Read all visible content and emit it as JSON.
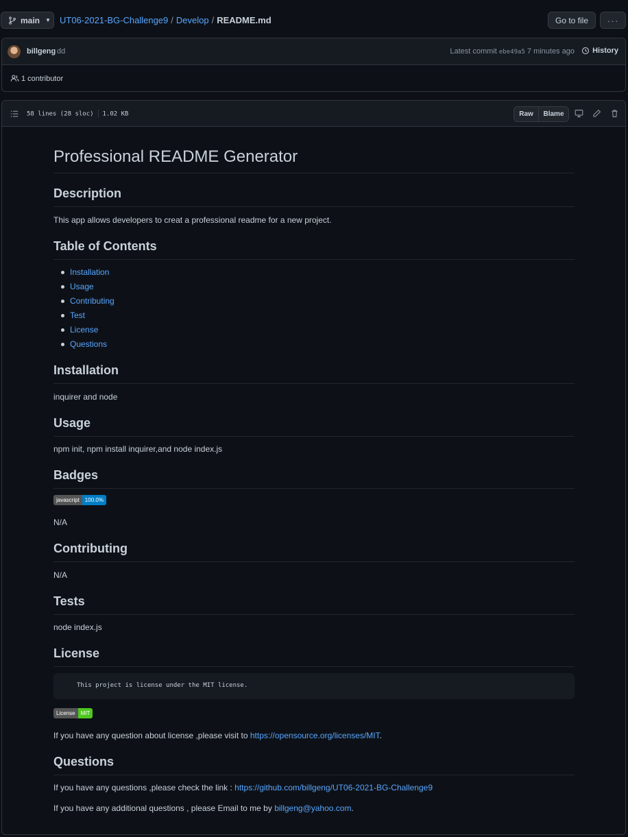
{
  "branch": {
    "label": "main"
  },
  "breadcrumb": {
    "repo": "UT06-2021-BG-Challenge9",
    "folder": "Develop",
    "file": "README.md",
    "separator": "/"
  },
  "toolbar": {
    "go_to_file": "Go to file",
    "more": "···"
  },
  "commit": {
    "author": "billgeng",
    "message": "dd",
    "latest_label": "Latest commit",
    "sha": "ebe49a5",
    "time": "7 minutes ago",
    "history_label": "History",
    "contributors": "1 contributor"
  },
  "file": {
    "lines": "58 lines (28 sloc)",
    "size": "1.02 KB",
    "raw_label": "Raw",
    "blame_label": "Blame"
  },
  "readme": {
    "title": "Professional README Generator",
    "description_heading": "Description",
    "description_text": "This app allows developers to creat a professional readme for a new project.",
    "toc_heading": "Table of Contents",
    "toc": [
      "Installation",
      "Usage",
      "Contributing",
      "Test",
      "License",
      "Questions"
    ],
    "installation_heading": "Installation",
    "installation_text": "inquirer and node",
    "usage_heading": "Usage",
    "usage_text": "npm init, npm install inquirer,and node index.js",
    "badges_heading": "Badges",
    "lang_badge": {
      "left": "javascript",
      "right": "100.0%",
      "left_color": "#555555",
      "right_color": "#007ec6"
    },
    "badges_text": "N/A",
    "contributing_heading": "Contributing",
    "contributing_text": "N/A",
    "tests_heading": "Tests",
    "tests_text": "node index.js",
    "license_heading": "License",
    "license_code": "This project is license under the MIT license.",
    "license_badge": {
      "left": "License",
      "right": "MIT",
      "left_color": "#555555",
      "right_color": "#4dc71f"
    },
    "license_text_prefix": "If you have any question about license ,please visit to ",
    "license_link": "https://opensource.org/licenses/MIT",
    "license_text_suffix": ".",
    "questions_heading": "Questions",
    "questions_text_prefix": "If you have any questions ,please check the link : ",
    "questions_link": "https://github.com/billgeng/UT06-2021-BG-Challenge9",
    "email_text_prefix": "If you have any additional questions , please Email to me by ",
    "email_link": "billgeng@yahoo.com",
    "email_text_suffix": "."
  },
  "colors": {
    "background": "#0d1117",
    "link": "#58a6ff",
    "text": "#c9d1d9",
    "muted": "#8b949e"
  }
}
